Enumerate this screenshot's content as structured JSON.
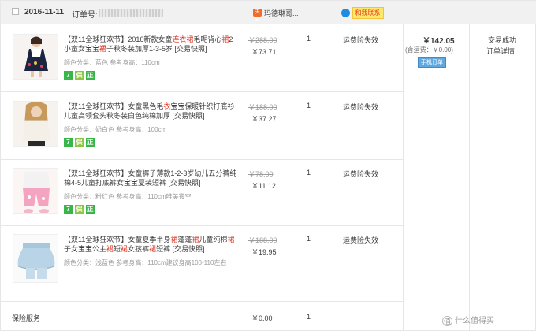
{
  "header": {
    "date": "2016-11-11",
    "order_label": "订单号:",
    "shop_name": "玛德琳哥...",
    "shop_icon": "天猫",
    "contact_label": "和我联系"
  },
  "items": [
    {
      "title_parts": [
        "【双11全球狂欢节】2016新款女童",
        {
          "hl": "连衣裙"
        },
        "毛呢背心",
        {
          "hl": "裙"
        },
        "2小童女宝宝",
        {
          "hl": "裙"
        },
        "子秋冬装加厚1-3-5岁 [交易快照]"
      ],
      "attr": "颜色分类：蓝色   参考身高：110cm",
      "orig_price": "￥288.00",
      "price": "￥73.71",
      "qty": "1",
      "service": "运费险失效"
    },
    {
      "title_parts": [
        "【双11全球狂欢节】女童黑色毛",
        {
          "hl": "衣"
        },
        "宝宝保暖针织打底衫儿童高领套头秋冬装白色纯棉加厚 [交易快照]"
      ],
      "attr": "颜色分类：奶白色   参考身高：100cm",
      "orig_price": "￥188.00",
      "price": "￥37.27",
      "qty": "1",
      "service": "运费险失效"
    },
    {
      "title_parts": [
        "【双11全球狂欢节】女童裤子薄款1-2-3岁幼儿五分裤纯棉4-5儿童打底裤女宝宝夏装短裤 [交易快照]"
      ],
      "attr": "颜色分类：粉红色   参考身高：110cm唯美镂空",
      "orig_price": "￥78.00",
      "price": "￥11.12",
      "qty": "1",
      "service": "运费险失效"
    },
    {
      "title_parts": [
        "【双11全球狂欢节】女童夏季半身",
        {
          "hl": "裙"
        },
        "蓬蓬",
        {
          "hl": "裙"
        },
        "儿童纯棉",
        {
          "hl": "裙"
        },
        "子女宝宝公主",
        {
          "hl": "裙"
        },
        "短",
        {
          "hl": "裙"
        },
        "女孩裤",
        {
          "hl": "裙"
        },
        "短裤 [交易快照]"
      ],
      "attr": "颜色分类：浅蓝色   参考身高：110cm建议身高100-110左右",
      "orig_price": "￥188.00",
      "price": "￥19.95",
      "qty": "1",
      "service": "运费险失效"
    }
  ],
  "tags": [
    "7",
    "保",
    "正"
  ],
  "order_total": {
    "total": "￥142.05",
    "shipping": "(含运费：￥0.00)",
    "mobile_label": "手机订单"
  },
  "status": {
    "status": "交易成功",
    "detail": "订单详情"
  },
  "insurance": {
    "label": "保险服务",
    "price": "￥0.00",
    "qty": "1"
  },
  "watermark": "值 什么值得买",
  "colors": {
    "accent_red": "#e0301e",
    "tag_green": "#3ab54a",
    "header_bg": "#f1f1f1"
  }
}
